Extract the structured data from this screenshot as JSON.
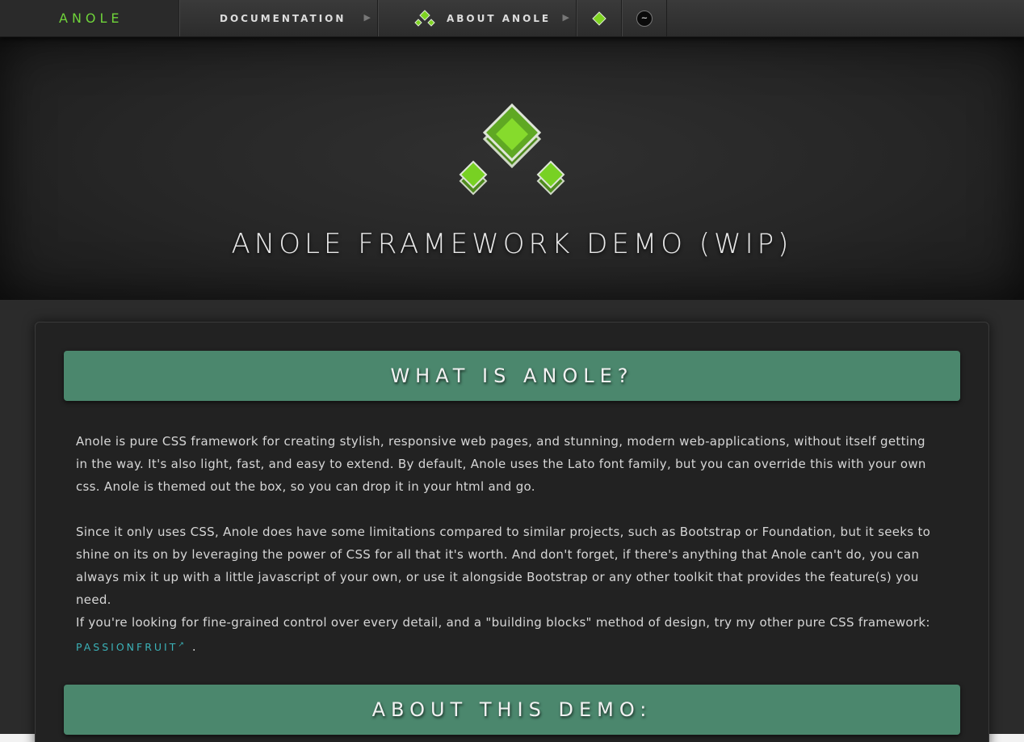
{
  "nav": {
    "brand": "ANOLE",
    "documentation": "DOCUMENTATION",
    "about": "ABOUT ANOLE",
    "arrow": "▶",
    "icons": [
      "anole-logo-icon",
      "green-diamond-icon",
      "link-circle-icon"
    ]
  },
  "hero": {
    "title": "ANOLE FRAMEWORK DEMO (WIP)"
  },
  "sections": [
    {
      "heading": "WHAT IS ANOLE?",
      "paragraphs": [
        "Anole is pure CSS framework for creating stylish, responsive web pages, and stunning, modern web-applications, without itself getting in the way. It's also light, fast, and easy to extend. By default, Anole uses the Lato font family, but you can override this with your own css. Anole is themed out the box, so you can drop it in your html and go.",
        "Since it only uses CSS, Anole does have some limitations compared to similar projects, such as Bootstrap or Foundation, but it seeks to shine on its on by leveraging the power of CSS for all that it's worth. And don't forget, if there's anything that Anole can't do, you can always mix it up with a little javascript of your own, or use it alongside Bootstrap or any other toolkit that provides the feature(s) you need.",
        "If you're looking for fine-grained control over every detail, and a \"building blocks\" method of design, try my other pure CSS framework:"
      ],
      "link_text": "PASSIONFRUIT",
      "link_suffix": "↗",
      "trailing": "."
    },
    {
      "heading": "ABOUT THIS DEMO:"
    }
  ],
  "colors": {
    "accent_green": "#6fd33a",
    "header_green": "#4b876d",
    "link_teal": "#3bb2b8"
  }
}
